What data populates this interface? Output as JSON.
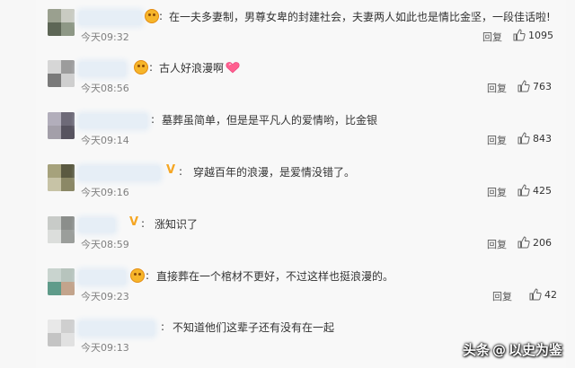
{
  "reply_label": "回复",
  "comments": [
    {
      "text": "在一夫多妻制，男尊女卑的封建社会，夫妻两人如此也是情比金坚，一段佳话啦!",
      "time": "今天09:32",
      "likes": "1095",
      "badge": "emoji"
    },
    {
      "text": "古人好浪漫啊",
      "time": "今天08:56",
      "likes": "763",
      "badge": "emoji"
    },
    {
      "text": "墓葬虽简单，但是是平凡人的爱情哟，比金银",
      "time": "今天09:14",
      "likes": "843",
      "badge": "none"
    },
    {
      "text": "穿越百年的浪漫，是爱情没错了。",
      "time": "今天09:16",
      "likes": "425",
      "badge": "v"
    },
    {
      "text": "涨知识了",
      "time": "今天08:59",
      "likes": "206",
      "badge": "v"
    },
    {
      "text": "直接葬在一个棺材不更好，不过这样也挺浪漫的。",
      "time": "今天09:23",
      "likes": "42",
      "badge": "emoji"
    },
    {
      "text": "不知道他们这辈子还有没有在一起",
      "time": "今天09:13",
      "likes": "",
      "badge": "none"
    }
  ],
  "watermark": {
    "brand": "头条",
    "account": "以史为鉴"
  },
  "colors": {
    "badge": "#f6b52a",
    "v_badge": "#f5a623",
    "heart": "#ff5f8f"
  }
}
